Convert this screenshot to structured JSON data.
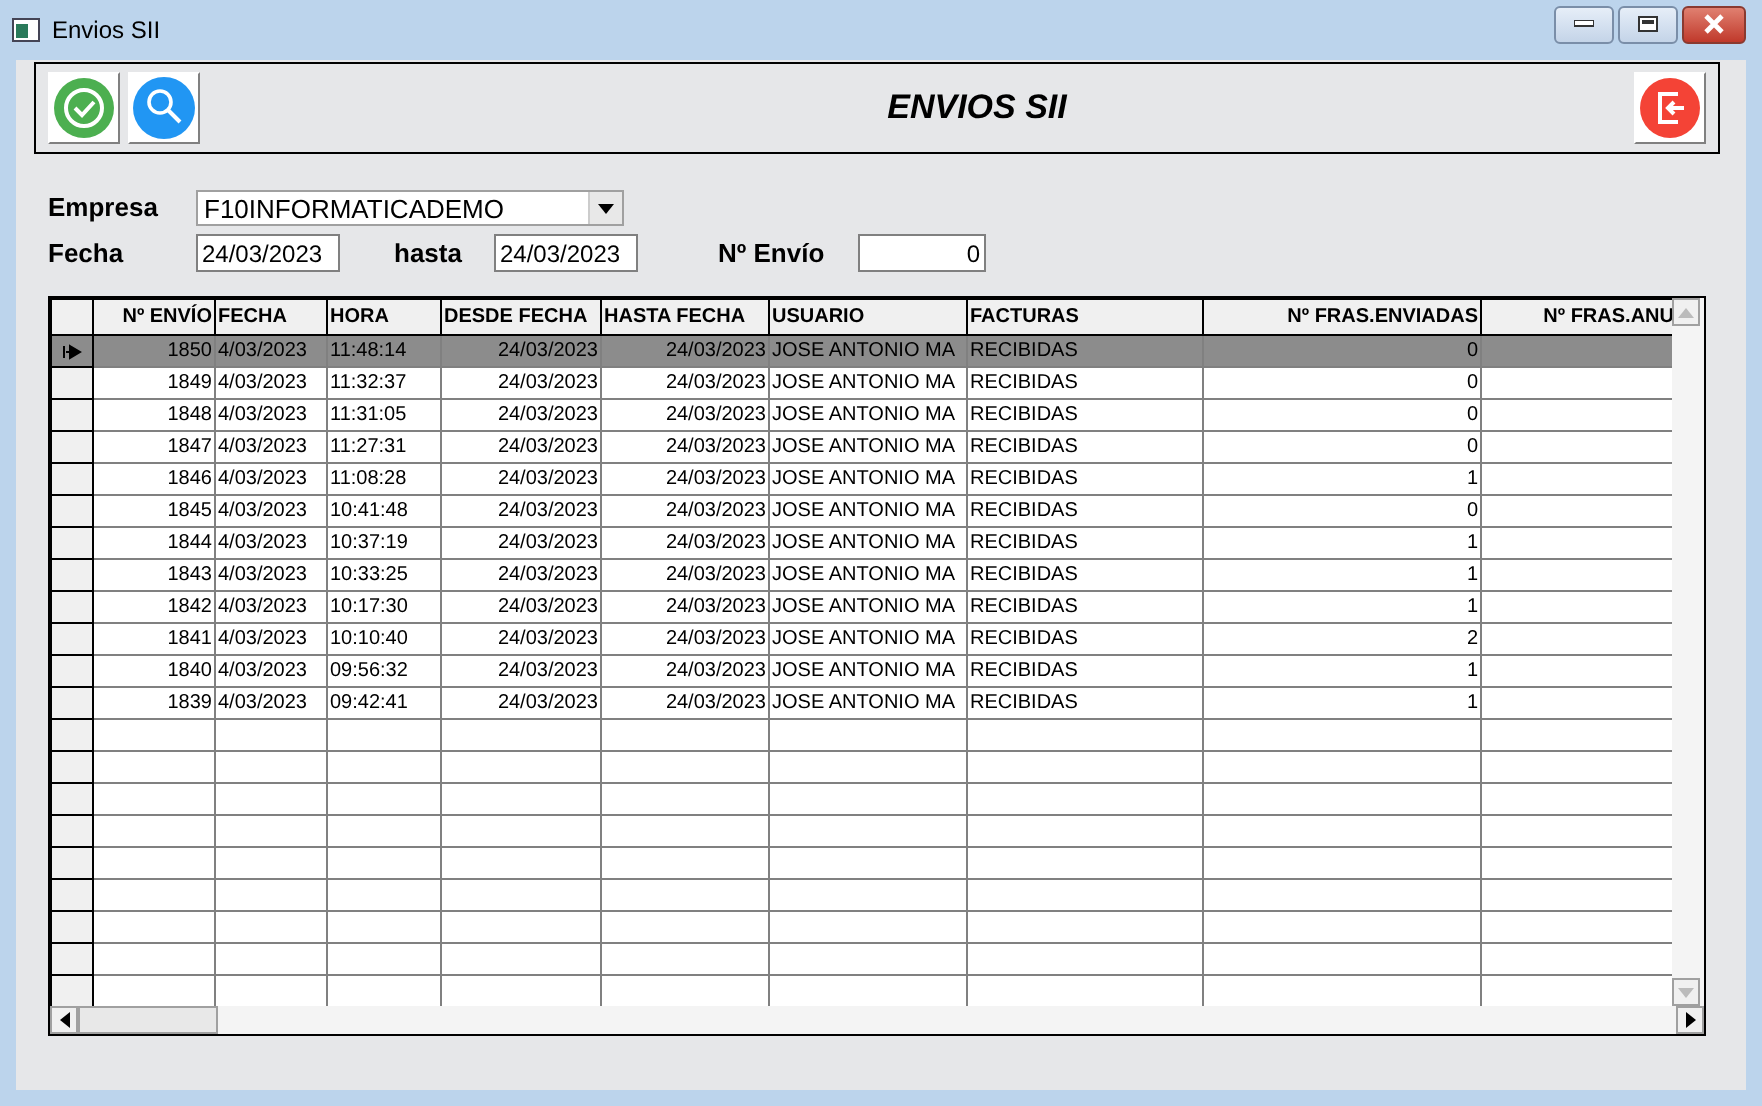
{
  "window": {
    "title": "Envios SII"
  },
  "toolbar": {
    "title": "ENVIOS SII"
  },
  "filters": {
    "empresa_label": "Empresa",
    "empresa_value": "F10INFORMATICADEMO",
    "fecha_label": "Fecha",
    "fecha_value": "24/03/2023",
    "hasta_label": "hasta",
    "hasta_value": "24/03/2023",
    "envio_label": "Nº Envío",
    "envio_value": "0"
  },
  "table": {
    "columns": [
      "Nº ENVÍO",
      "FECHA",
      "HORA",
      "DESDE FECHA",
      "HASTA FECHA",
      "USUARIO",
      "FACTURAS",
      "Nº FRAS.ENVIADAS",
      "Nº FRAS.ANU"
    ],
    "rows": [
      {
        "selected": true,
        "cells": [
          "1850",
          "4/03/2023",
          "11:48:14",
          "24/03/2023",
          "24/03/2023",
          "JOSE ANTONIO MA",
          "RECIBIDAS",
          "0"
        ]
      },
      {
        "selected": false,
        "cells": [
          "1849",
          "4/03/2023",
          "11:32:37",
          "24/03/2023",
          "24/03/2023",
          "JOSE ANTONIO MA",
          "RECIBIDAS",
          "0"
        ]
      },
      {
        "selected": false,
        "cells": [
          "1848",
          "4/03/2023",
          "11:31:05",
          "24/03/2023",
          "24/03/2023",
          "JOSE ANTONIO MA",
          "RECIBIDAS",
          "0"
        ]
      },
      {
        "selected": false,
        "cells": [
          "1847",
          "4/03/2023",
          "11:27:31",
          "24/03/2023",
          "24/03/2023",
          "JOSE ANTONIO MA",
          "RECIBIDAS",
          "0"
        ]
      },
      {
        "selected": false,
        "cells": [
          "1846",
          "4/03/2023",
          "11:08:28",
          "24/03/2023",
          "24/03/2023",
          "JOSE ANTONIO MA",
          "RECIBIDAS",
          "1"
        ]
      },
      {
        "selected": false,
        "cells": [
          "1845",
          "4/03/2023",
          "10:41:48",
          "24/03/2023",
          "24/03/2023",
          "JOSE ANTONIO MA",
          "RECIBIDAS",
          "0"
        ]
      },
      {
        "selected": false,
        "cells": [
          "1844",
          "4/03/2023",
          "10:37:19",
          "24/03/2023",
          "24/03/2023",
          "JOSE ANTONIO MA",
          "RECIBIDAS",
          "1"
        ]
      },
      {
        "selected": false,
        "cells": [
          "1843",
          "4/03/2023",
          "10:33:25",
          "24/03/2023",
          "24/03/2023",
          "JOSE ANTONIO MA",
          "RECIBIDAS",
          "1"
        ]
      },
      {
        "selected": false,
        "cells": [
          "1842",
          "4/03/2023",
          "10:17:30",
          "24/03/2023",
          "24/03/2023",
          "JOSE ANTONIO MA",
          "RECIBIDAS",
          "1"
        ]
      },
      {
        "selected": false,
        "cells": [
          "1841",
          "4/03/2023",
          "10:10:40",
          "24/03/2023",
          "24/03/2023",
          "JOSE ANTONIO MA",
          "RECIBIDAS",
          "2"
        ]
      },
      {
        "selected": false,
        "cells": [
          "1840",
          "4/03/2023",
          "09:56:32",
          "24/03/2023",
          "24/03/2023",
          "JOSE ANTONIO MA",
          "RECIBIDAS",
          "1"
        ]
      },
      {
        "selected": false,
        "cells": [
          "1839",
          "4/03/2023",
          "09:42:41",
          "24/03/2023",
          "24/03/2023",
          "JOSE ANTONIO MA",
          "RECIBIDAS",
          "1"
        ]
      }
    ]
  }
}
